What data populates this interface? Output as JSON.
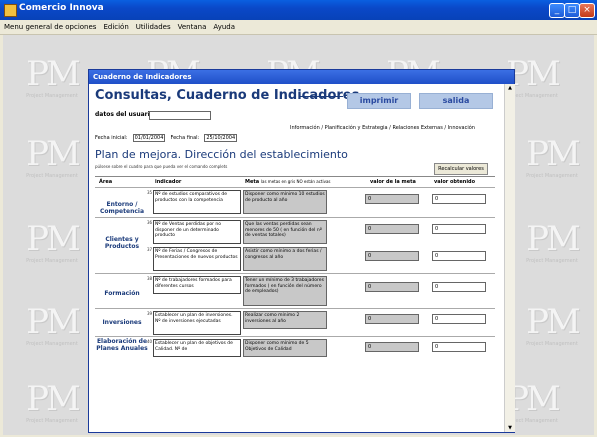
{
  "window": {
    "title": "Comercio Innova"
  },
  "menu": [
    "Menu general de opciones",
    "Edición",
    "Utilidades",
    "Ventana",
    "Ayuda"
  ],
  "watermark": {
    "logo": "PM",
    "subtitle": "Project Management"
  },
  "form": {
    "window_title": "Cuaderno de Indicadores",
    "heading": "Consultas, Cuaderno de Indicadores",
    "imprimir": "imprimir",
    "salida": "salida",
    "user_label": "datos del usuario:",
    "fecha_inicial_label": "Fecha inicial:",
    "fecha_inicial": "01/01/2004",
    "fecha_final_label": "Fecha final:",
    "fecha_final": "25/10/2004",
    "breadcrumb": "Información / Planificación y Estrategia / Relaciones Externas / Innovación",
    "plan_title": "Plan de mejora. Dirección del establecimiento",
    "hint": "púlsese sobre el cuadro para que pueda ver el comando complets",
    "recalc": "Recalcular valores",
    "columns": {
      "area": "Área",
      "indicador": "indicador",
      "meta": "Meta",
      "meta_note": "las metas en gris NO están activas",
      "valor_meta": "valor de la meta",
      "valor_obtenido": "valor obtenido"
    },
    "rows": [
      {
        "area": "Entorno / Competencia",
        "num": "35",
        "indicador": "Nº de estudios comparativos de productos con la competencia",
        "meta": "Disponer como mínimo 10 estudios de producto al año",
        "valor_meta": "0",
        "valor_obtenido": "0"
      },
      {
        "area": "Clientes y Productos",
        "num": "36",
        "indicador": "Nº de Ventas perdidas por no disponer de un determinado producto",
        "meta": "Que las ventas perdidas sean menores de 50 ( en función del nº de ventas totales)",
        "valor_meta": "0",
        "valor_obtenido": "0"
      },
      {
        "area": "",
        "num": "37",
        "indicador": "Nº de Ferias / Congresos de Presentaciones de nuevos productos",
        "meta": "Asistir como mínimo a dos ferias / congresos al año",
        "valor_meta": "0",
        "valor_obtenido": "0"
      },
      {
        "area": "Formación",
        "num": "38",
        "indicador": "Nº de trabajadores formados para diferentes cursos",
        "meta": "Tener un mínimo de 3 trabajadores formados ( en función del número de empleados)",
        "valor_meta": "0",
        "valor_obtenido": "0"
      },
      {
        "area": "Inversiones",
        "num": "39",
        "indicador": "Establecer un plan de inversiones. Nº de inversiones ejecutadas",
        "meta": "Realizar como mínimo 2 inversiones al año",
        "valor_meta": "0",
        "valor_obtenido": "0"
      },
      {
        "area": "Elaboración de Planes Anuales",
        "num": "40",
        "indicador": "Establecer un plan de objetivos de Calidad. Nº de",
        "meta": "Disponer como mínimo de 5 Objetivos de Calidad",
        "valor_meta": "0",
        "valor_obtenido": "0"
      }
    ]
  }
}
